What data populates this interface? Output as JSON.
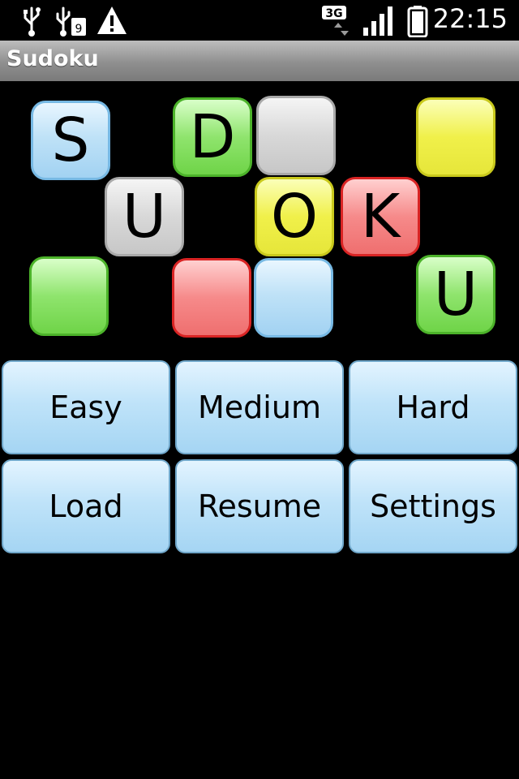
{
  "status_bar": {
    "time": "22:15",
    "network": "3G",
    "icons": [
      "usb-icon",
      "usb-sd-icon",
      "warning-icon",
      "network-3g-icon",
      "signal-icon",
      "battery-icon"
    ]
  },
  "app": {
    "title": "Sudoku"
  },
  "logo": {
    "letters": [
      "S",
      "D",
      "U",
      "O",
      "K",
      "U"
    ]
  },
  "menu": {
    "easy": "Easy",
    "medium": "Medium",
    "hard": "Hard",
    "load": "Load",
    "resume": "Resume",
    "settings": "Settings"
  },
  "colors": {
    "blue": "#a2d2f2",
    "green": "#6fd448",
    "grey": "#c7c7c7",
    "yellow": "#e6e63a",
    "red": "#ef6f6f"
  }
}
